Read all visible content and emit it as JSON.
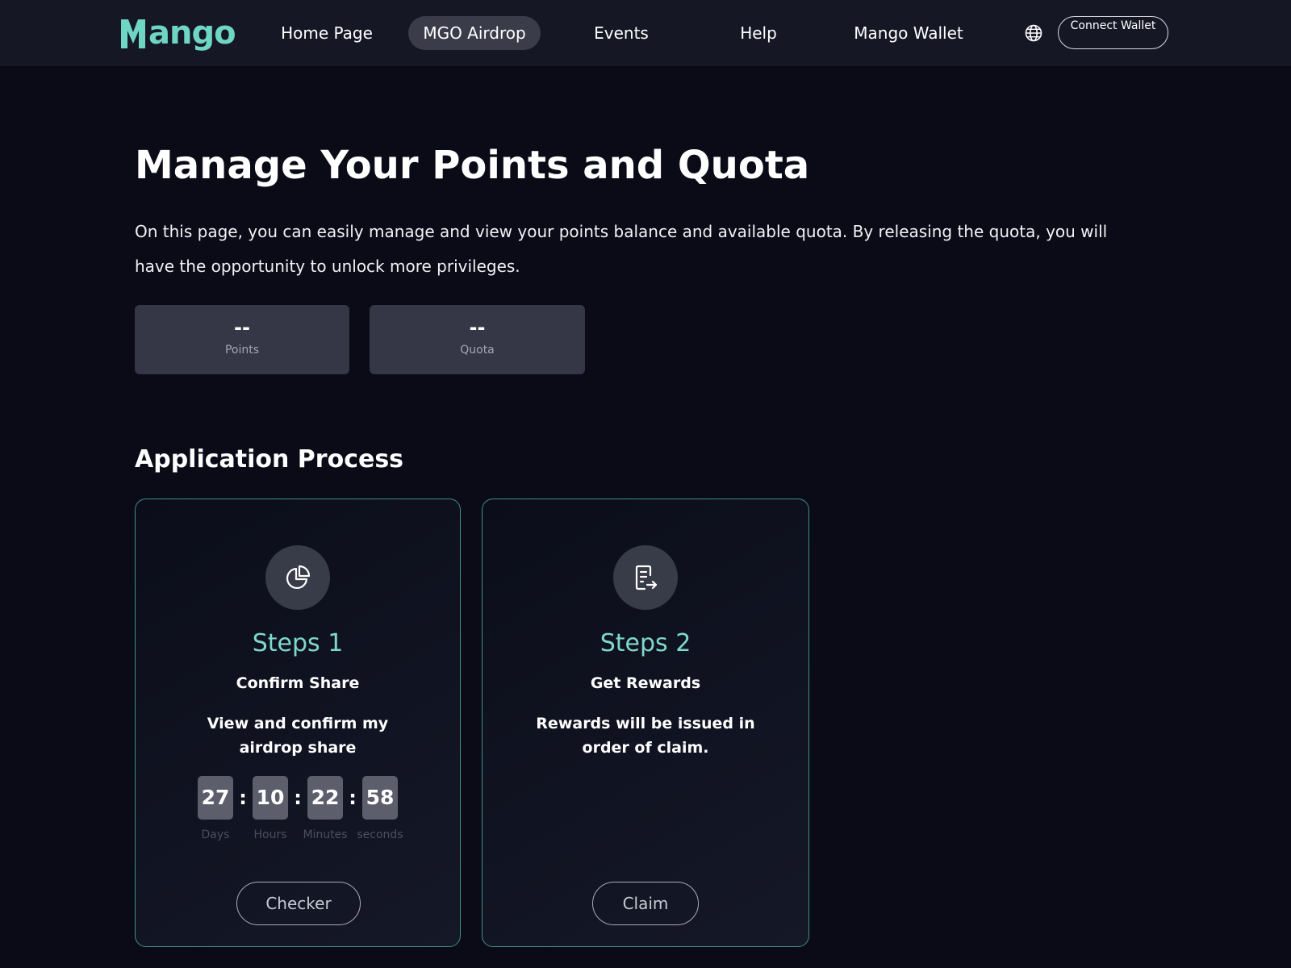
{
  "header": {
    "logo_text": "ango",
    "logo_full": "Mango",
    "nav": [
      {
        "label": "Home Page",
        "active": false
      },
      {
        "label": "MGO Airdrop",
        "active": true
      },
      {
        "label": "Events",
        "active": false
      },
      {
        "label": "Help",
        "active": false
      },
      {
        "label": "Mango Wallet",
        "active": false
      }
    ],
    "language_icon": "globe-icon",
    "connect_wallet_label": "Connect Wallet"
  },
  "hero": {
    "title": "Manage Your Points and Quota",
    "description": "On this page, you can easily manage and view your points balance and available quota. By releasing the quota, you will have the opportunity to unlock more privileges.",
    "stats": [
      {
        "value": "--",
        "label": "Points"
      },
      {
        "value": "--",
        "label": "Quota"
      }
    ]
  },
  "process": {
    "title": "Application Process",
    "steps": [
      {
        "icon": "pie-chart-icon",
        "title": "Steps 1",
        "subtitle": "Confirm Share",
        "description": "View and confirm my airdrop share",
        "countdown": [
          {
            "value": "27",
            "label": "Days"
          },
          {
            "value": "10",
            "label": "Hours"
          },
          {
            "value": "22",
            "label": "Minutes"
          },
          {
            "value": "58",
            "label": "seconds"
          }
        ],
        "separator": ":",
        "button_label": "Checker"
      },
      {
        "icon": "document-export-icon",
        "title": "Steps 2",
        "subtitle": "Get Rewards",
        "description": "Rewards will be issued in order of claim.",
        "button_label": "Claim"
      }
    ]
  },
  "colors": {
    "page_bg": "#0a0b17",
    "header_bg": "#161725",
    "accent": "#6fd6c6",
    "card_border": "#3f8f87",
    "stat_bg": "#353646"
  }
}
